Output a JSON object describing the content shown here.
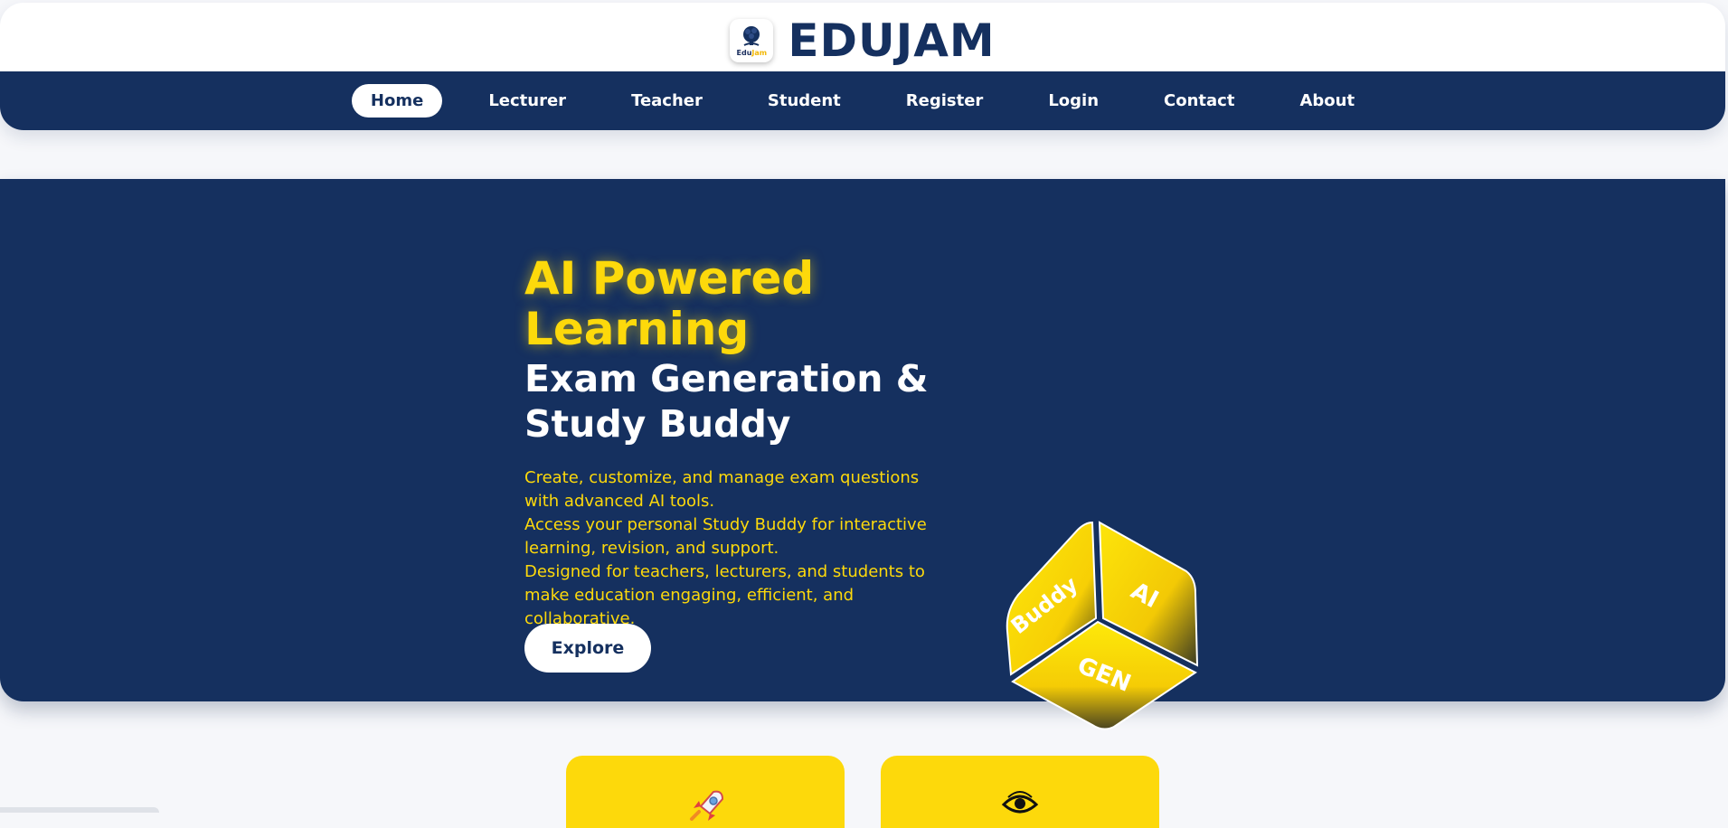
{
  "header": {
    "brand_name": "EDUJAM",
    "logo": {
      "prefix": "Edu",
      "suffix": "Jam",
      "icon": "tree-head-icon"
    }
  },
  "nav": {
    "items": [
      {
        "label": "Home",
        "active": true
      },
      {
        "label": "Lecturer",
        "active": false
      },
      {
        "label": "Teacher",
        "active": false
      },
      {
        "label": "Student",
        "active": false
      },
      {
        "label": "Register",
        "active": false
      },
      {
        "label": "Login",
        "active": false
      },
      {
        "label": "Contact",
        "active": false
      },
      {
        "label": "About",
        "active": false
      }
    ]
  },
  "hero": {
    "title_line1": "AI Powered",
    "title_line2": "Learning",
    "subtitle_line1": "Exam Generation &",
    "subtitle_line2": "Study Buddy",
    "description": [
      "Create, customize, and manage exam questions with advanced AI tools.",
      "Access your personal Study Buddy for interactive learning, revision, and support.",
      "Designed for teachers, lecturers, and students to make education engaging, efficient, and collaborative."
    ],
    "cta_label": "Explore",
    "cube_faces": {
      "left": "Buddy",
      "right": "AI",
      "top": "GEN"
    }
  },
  "cards": [
    {
      "icon": "rocket-icon"
    },
    {
      "icon": "eye-icon"
    }
  ],
  "colors": {
    "navy": "#15305f",
    "accent_yellow": "#fdd90b",
    "background": "#f6f7fa",
    "white": "#ffffff"
  }
}
